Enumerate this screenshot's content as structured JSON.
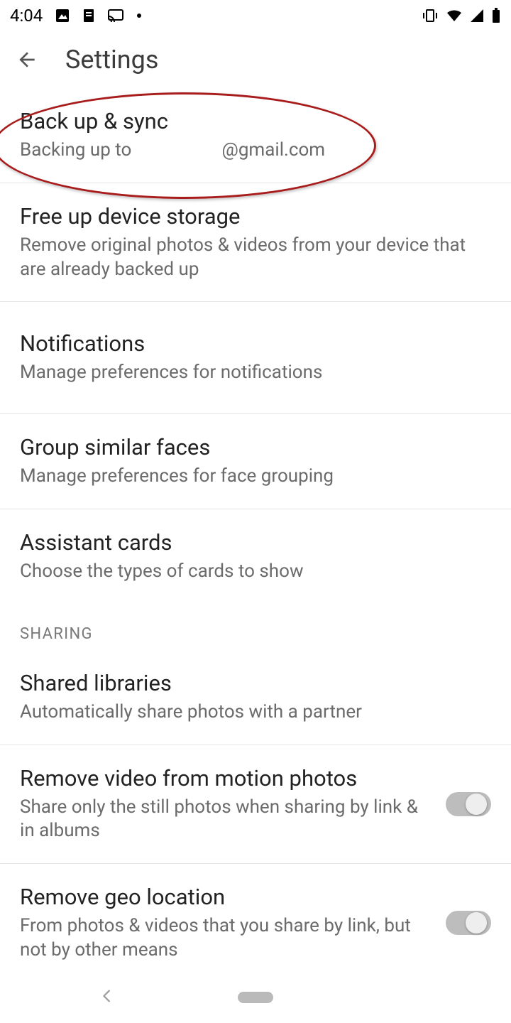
{
  "status": {
    "time": "4:04"
  },
  "header": {
    "title": "Settings"
  },
  "items": [
    {
      "title": "Back up & sync",
      "sub": "Backing up to ⠀⠀⠀⠀⠀⠀  @gmail.com"
    },
    {
      "title": "Free up device storage",
      "sub": "Remove original photos & videos from your device that are already backed up"
    },
    {
      "title": "Notifications",
      "sub": "Manage preferences for notifications"
    },
    {
      "title": "Group similar faces",
      "sub": "Manage preferences for face grouping"
    },
    {
      "title": "Assistant cards",
      "sub": "Choose the types of cards to show"
    }
  ],
  "section_sharing": "SHARING",
  "sharing_items": [
    {
      "title": "Shared libraries",
      "sub": "Automatically share photos with a partner"
    },
    {
      "title": "Remove video from motion photos",
      "sub": "Share only the still photos when sharing by link & in albums",
      "toggle": false
    },
    {
      "title": "Remove geo location",
      "sub": "From photos & videos that you share by link, but not by other means",
      "toggle": false
    }
  ]
}
